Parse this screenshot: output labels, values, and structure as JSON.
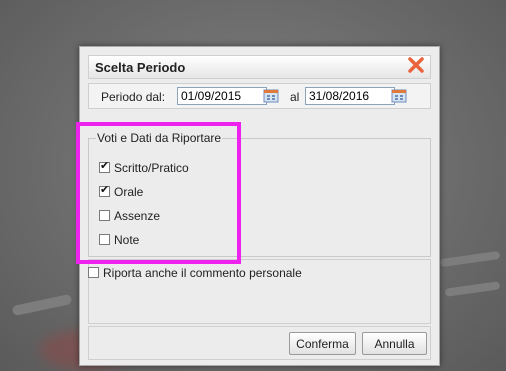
{
  "dialog": {
    "title": "Scelta Periodo",
    "close_icon": "close-x-icon",
    "close_color": "#e8643c"
  },
  "period": {
    "from_label": "Periodo dal:",
    "from_value": "01/09/2015",
    "to_label": "al",
    "to_value": "31/08/2016",
    "calendar_icon": "calendar-icon"
  },
  "grades_section": {
    "legend": "Voti e Dati da Riportare",
    "items": [
      {
        "label": "Scritto/Pratico",
        "checked": true
      },
      {
        "label": "Orale",
        "checked": true
      },
      {
        "label": "Assenze",
        "checked": false
      },
      {
        "label": "Note",
        "checked": false
      }
    ]
  },
  "personal_comment": {
    "label": "Riporta anche il commento personale",
    "checked": false
  },
  "buttons": {
    "confirm": "Conferma",
    "cancel": "Annulla"
  },
  "colors": {
    "highlight": "#ee22ee"
  }
}
